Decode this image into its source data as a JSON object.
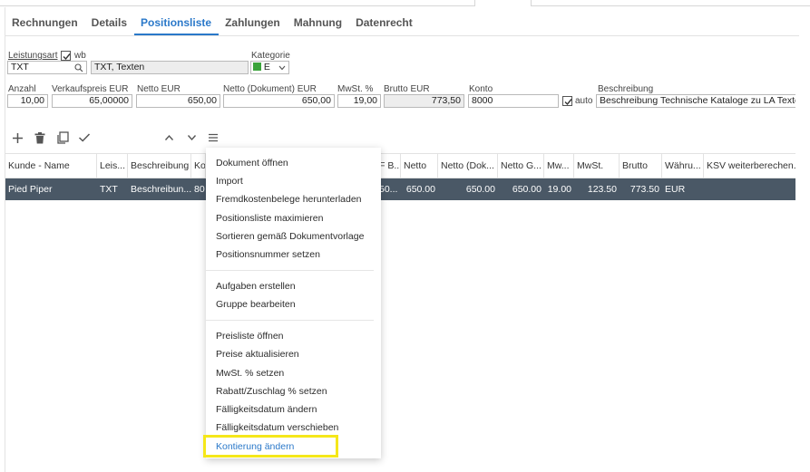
{
  "tabs": [
    "Rechnungen",
    "Details",
    "Positionsliste",
    "Zahlungen",
    "Mahnung",
    "Datenrecht"
  ],
  "active_tab": "Positionsliste",
  "form": {
    "leistungsart_label": "Leistungsart",
    "wb_label": "wb",
    "leistungsart_value": "TXT",
    "leistungsart_desc": "TXT, Texten",
    "kategorie_label": "Kategorie",
    "kategorie_value": "E",
    "kategorie_color": "#3aa33a",
    "anzahl_label": "Anzahl",
    "anzahl_value": "10,00",
    "vk_label": "Verkaufspreis EUR",
    "vk_value": "65,00000",
    "netto_label": "Netto EUR",
    "netto_value": "650,00",
    "netto_dok_label": "Netto (Dokument) EUR",
    "netto_dok_value": "650,00",
    "mwst_label": "MwSt. %",
    "mwst_value": "19,00",
    "brutto_label": "Brutto EUR",
    "brutto_value": "773,50",
    "konto_label": "Konto",
    "konto_value": "8000",
    "auto_label": "auto",
    "beschreibung_label": "Beschreibung",
    "beschreibung_value": "Beschreibung Technische Kataloge zu LA Texten Zeile"
  },
  "toolbar_icons": [
    "plus-icon",
    "trash-icon",
    "copy-icon",
    "check-icon",
    "chevron-up-icon",
    "chevron-down-icon",
    "menu-icon"
  ],
  "columns": [
    "Kunde - Name",
    "Leis...",
    "Beschreibung",
    "Ko",
    "F B...",
    "Netto",
    "Netto (Dok...",
    "Netto G...",
    "Mw...",
    "MwSt.",
    "Brutto",
    "Währu...",
    "KSV weiterberechen..."
  ],
  "row": {
    "kunde": "Pied Piper",
    "leistung": "TXT",
    "beschreibung": "Beschreibun...",
    "ko": "80",
    "fb": "50...",
    "netto": "650.00",
    "netto_dok": "650.00",
    "netto_g": "650.00",
    "mw": "19.00",
    "mwst": "123.50",
    "brutto": "773.50",
    "waehrung": "EUR",
    "ksv": ""
  },
  "menu": {
    "group1": [
      "Dokument öffnen",
      "Import",
      "Fremdkostenbelege herunterladen",
      "Positionsliste maximieren",
      "Sortieren gemäß Dokumentvorlage",
      "Positionsnummer setzen"
    ],
    "group2": [
      "Aufgaben erstellen",
      "Gruppe bearbeiten"
    ],
    "group3": [
      "Preisliste öffnen",
      "Preise aktualisieren",
      "MwSt. % setzen",
      "Rabatt/Zuschlag % setzen",
      "Fälligkeitsdatum ändern",
      "Fälligkeitsdatum verschieben",
      "Kontierung ändern"
    ]
  },
  "colors": {
    "accent": "#2a78c9",
    "selected_row": "#4a5866",
    "highlight": "#f5e71a"
  }
}
